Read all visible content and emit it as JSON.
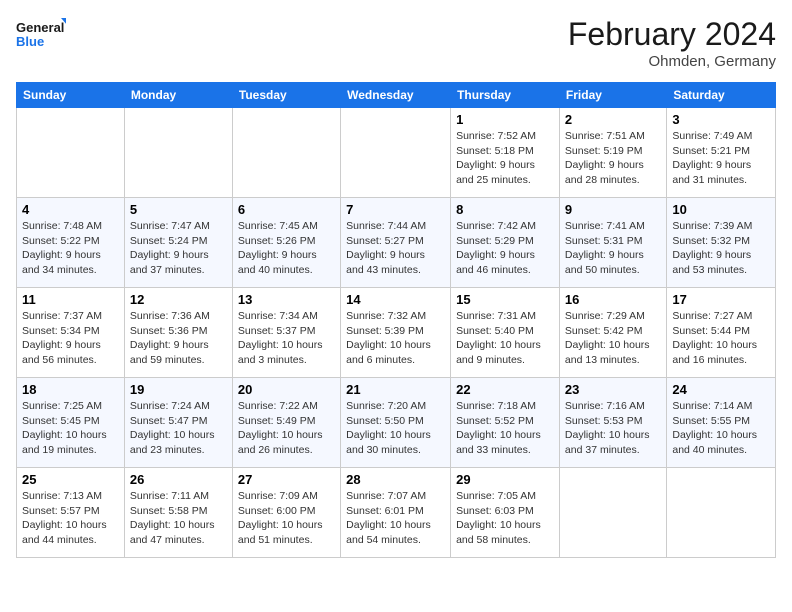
{
  "logo": {
    "general": "General",
    "blue": "Blue"
  },
  "header": {
    "title": "February 2024",
    "subtitle": "Ohmden, Germany"
  },
  "days_of_week": [
    "Sunday",
    "Monday",
    "Tuesday",
    "Wednesday",
    "Thursday",
    "Friday",
    "Saturday"
  ],
  "weeks": [
    [
      {
        "day": "",
        "info": ""
      },
      {
        "day": "",
        "info": ""
      },
      {
        "day": "",
        "info": ""
      },
      {
        "day": "",
        "info": ""
      },
      {
        "day": "1",
        "info": "Sunrise: 7:52 AM\nSunset: 5:18 PM\nDaylight: 9 hours\nand 25 minutes."
      },
      {
        "day": "2",
        "info": "Sunrise: 7:51 AM\nSunset: 5:19 PM\nDaylight: 9 hours\nand 28 minutes."
      },
      {
        "day": "3",
        "info": "Sunrise: 7:49 AM\nSunset: 5:21 PM\nDaylight: 9 hours\nand 31 minutes."
      }
    ],
    [
      {
        "day": "4",
        "info": "Sunrise: 7:48 AM\nSunset: 5:22 PM\nDaylight: 9 hours\nand 34 minutes."
      },
      {
        "day": "5",
        "info": "Sunrise: 7:47 AM\nSunset: 5:24 PM\nDaylight: 9 hours\nand 37 minutes."
      },
      {
        "day": "6",
        "info": "Sunrise: 7:45 AM\nSunset: 5:26 PM\nDaylight: 9 hours\nand 40 minutes."
      },
      {
        "day": "7",
        "info": "Sunrise: 7:44 AM\nSunset: 5:27 PM\nDaylight: 9 hours\nand 43 minutes."
      },
      {
        "day": "8",
        "info": "Sunrise: 7:42 AM\nSunset: 5:29 PM\nDaylight: 9 hours\nand 46 minutes."
      },
      {
        "day": "9",
        "info": "Sunrise: 7:41 AM\nSunset: 5:31 PM\nDaylight: 9 hours\nand 50 minutes."
      },
      {
        "day": "10",
        "info": "Sunrise: 7:39 AM\nSunset: 5:32 PM\nDaylight: 9 hours\nand 53 minutes."
      }
    ],
    [
      {
        "day": "11",
        "info": "Sunrise: 7:37 AM\nSunset: 5:34 PM\nDaylight: 9 hours\nand 56 minutes."
      },
      {
        "day": "12",
        "info": "Sunrise: 7:36 AM\nSunset: 5:36 PM\nDaylight: 9 hours\nand 59 minutes."
      },
      {
        "day": "13",
        "info": "Sunrise: 7:34 AM\nSunset: 5:37 PM\nDaylight: 10 hours\nand 3 minutes."
      },
      {
        "day": "14",
        "info": "Sunrise: 7:32 AM\nSunset: 5:39 PM\nDaylight: 10 hours\nand 6 minutes."
      },
      {
        "day": "15",
        "info": "Sunrise: 7:31 AM\nSunset: 5:40 PM\nDaylight: 10 hours\nand 9 minutes."
      },
      {
        "day": "16",
        "info": "Sunrise: 7:29 AM\nSunset: 5:42 PM\nDaylight: 10 hours\nand 13 minutes."
      },
      {
        "day": "17",
        "info": "Sunrise: 7:27 AM\nSunset: 5:44 PM\nDaylight: 10 hours\nand 16 minutes."
      }
    ],
    [
      {
        "day": "18",
        "info": "Sunrise: 7:25 AM\nSunset: 5:45 PM\nDaylight: 10 hours\nand 19 minutes."
      },
      {
        "day": "19",
        "info": "Sunrise: 7:24 AM\nSunset: 5:47 PM\nDaylight: 10 hours\nand 23 minutes."
      },
      {
        "day": "20",
        "info": "Sunrise: 7:22 AM\nSunset: 5:49 PM\nDaylight: 10 hours\nand 26 minutes."
      },
      {
        "day": "21",
        "info": "Sunrise: 7:20 AM\nSunset: 5:50 PM\nDaylight: 10 hours\nand 30 minutes."
      },
      {
        "day": "22",
        "info": "Sunrise: 7:18 AM\nSunset: 5:52 PM\nDaylight: 10 hours\nand 33 minutes."
      },
      {
        "day": "23",
        "info": "Sunrise: 7:16 AM\nSunset: 5:53 PM\nDaylight: 10 hours\nand 37 minutes."
      },
      {
        "day": "24",
        "info": "Sunrise: 7:14 AM\nSunset: 5:55 PM\nDaylight: 10 hours\nand 40 minutes."
      }
    ],
    [
      {
        "day": "25",
        "info": "Sunrise: 7:13 AM\nSunset: 5:57 PM\nDaylight: 10 hours\nand 44 minutes."
      },
      {
        "day": "26",
        "info": "Sunrise: 7:11 AM\nSunset: 5:58 PM\nDaylight: 10 hours\nand 47 minutes."
      },
      {
        "day": "27",
        "info": "Sunrise: 7:09 AM\nSunset: 6:00 PM\nDaylight: 10 hours\nand 51 minutes."
      },
      {
        "day": "28",
        "info": "Sunrise: 7:07 AM\nSunset: 6:01 PM\nDaylight: 10 hours\nand 54 minutes."
      },
      {
        "day": "29",
        "info": "Sunrise: 7:05 AM\nSunset: 6:03 PM\nDaylight: 10 hours\nand 58 minutes."
      },
      {
        "day": "",
        "info": ""
      },
      {
        "day": "",
        "info": ""
      }
    ]
  ]
}
